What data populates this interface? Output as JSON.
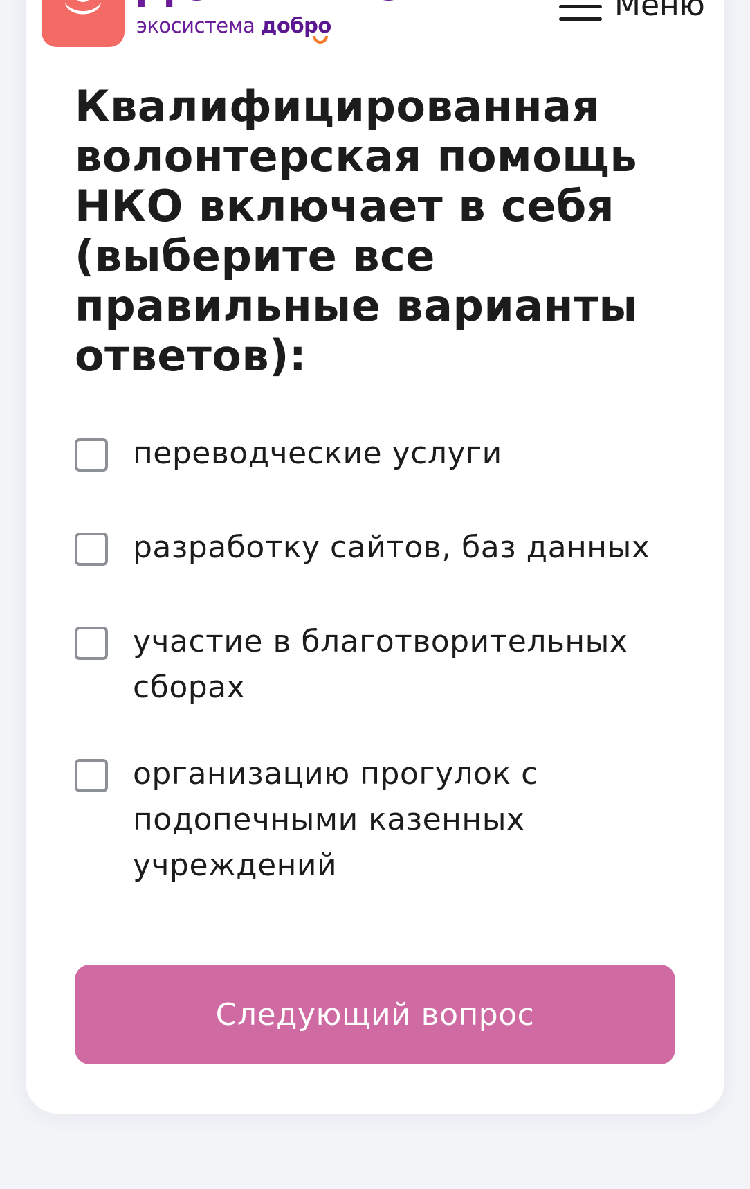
{
  "header": {
    "logo_text": "ДОБРИНО",
    "logo_sub_prefix": "экосистема",
    "logo_sub_brand": "добро",
    "menu_label": "Меню"
  },
  "question": {
    "title": "Квалифицированная волонтерская помощь НКО включает в себя (выберите все правильные варианты ответов):"
  },
  "options": [
    {
      "label": "переводческие услуги",
      "checked": false
    },
    {
      "label": "разработку сайтов, баз данных",
      "checked": false
    },
    {
      "label": "участие в благотворительных сборах",
      "checked": false
    },
    {
      "label": "организацию прогулок с подопечными казенных учреждений",
      "checked": false
    }
  ],
  "actions": {
    "next_label": "Следующий вопрос"
  },
  "colors": {
    "brand_purple": "#6a1b9a",
    "logo_tile": "#f46a64",
    "smile_orange": "#f57c2a",
    "button_pink": "#d06aa2",
    "checkbox_border": "#8e9098",
    "text": "#1c1c1c"
  }
}
